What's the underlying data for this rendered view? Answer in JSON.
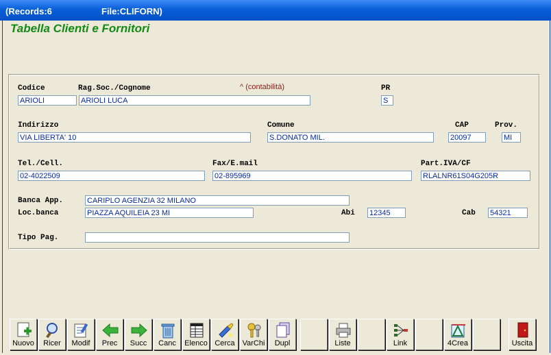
{
  "window": {
    "records": "(Records:6",
    "file": "File:CLIFORN)"
  },
  "heading": "Tabella Clienti e Fornitori",
  "form": {
    "codice": {
      "label": "Codice",
      "value": "ARIOLI"
    },
    "ragsoc": {
      "label": "Rag.Soc./Cognome",
      "value": "ARIOLI LUCA"
    },
    "contabilita_note": "^ (contabilità)",
    "pr": {
      "label": "PR",
      "value": "S"
    },
    "indirizzo": {
      "label": "Indirizzo",
      "value": "VIA LIBERTA' 10"
    },
    "comune": {
      "label": "Comune",
      "value": "S.DONATO MIL."
    },
    "cap": {
      "label": "CAP",
      "value": "20097"
    },
    "prov": {
      "label": "Prov.",
      "value": "MI"
    },
    "tel": {
      "label": "Tel./Cell.",
      "value": "02-4022509"
    },
    "fax": {
      "label": "Fax/E.mail",
      "value": "02-895969"
    },
    "piva": {
      "label": "Part.IVA/CF",
      "value": "RLALNR61S04G205R"
    },
    "banca": {
      "label": "Banca App.",
      "value": "CARIPLO AGENZIA 32 MILANO"
    },
    "locbanca": {
      "label": "Loc.banca",
      "value": "PIAZZA AQUILEIA 23  MI"
    },
    "abi": {
      "label": "Abi",
      "value": "12345"
    },
    "cab": {
      "label": "Cab",
      "value": "54321"
    },
    "tipopag": {
      "label": "Tipo Pag.",
      "value": ""
    }
  },
  "toolbar": {
    "nuovo": "Nuovo",
    "ricer": "Ricer",
    "modif": "Modif",
    "prec": "Prec",
    "succ": "Succ",
    "canc": "Canc",
    "elenco": "Elenco",
    "cerca": "Cerca",
    "varchi": "VarChi",
    "dupl": "Dupl",
    "liste": "Liste",
    "link": "Link",
    "crea": "4Crea",
    "uscita": "Uscita"
  },
  "colors": {
    "title_bar": "#0a5fd8",
    "heading": "#138a13",
    "field_text": "#0a2a9c",
    "note": "#8b1a1a"
  }
}
